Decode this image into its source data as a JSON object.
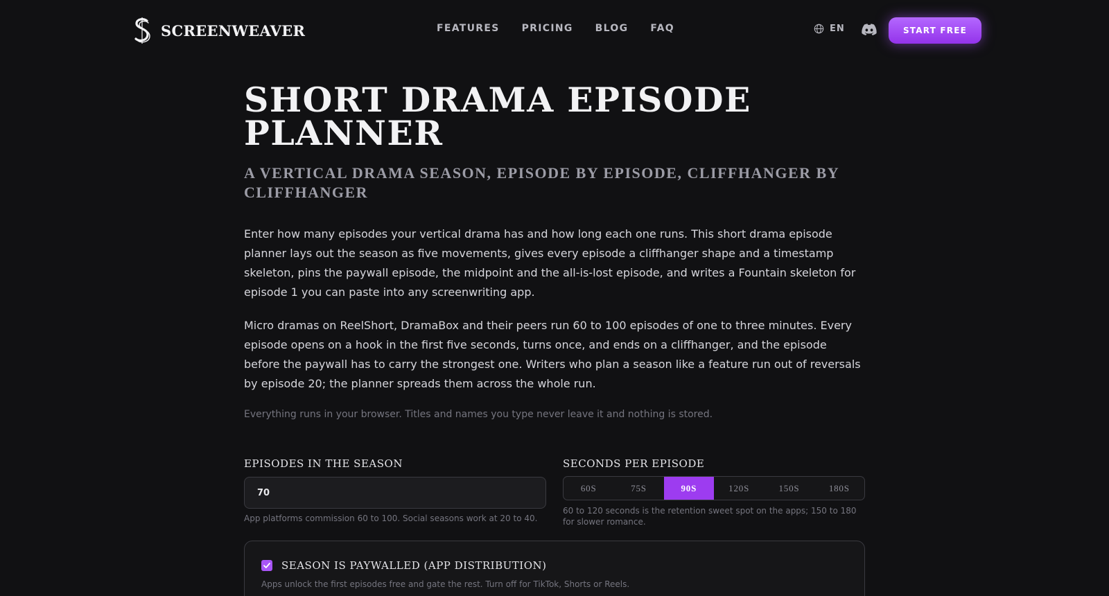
{
  "header": {
    "brand": "SCREENWEAVER",
    "nav": [
      {
        "label": "FEATURES"
      },
      {
        "label": "PRICING"
      },
      {
        "label": "BLOG"
      },
      {
        "label": "FAQ"
      }
    ],
    "language": "EN",
    "cta_label": "START FREE"
  },
  "page": {
    "title": "SHORT DRAMA EPISODE PLANNER",
    "subtitle": "A VERTICAL DRAMA SEASON, EPISODE BY EPISODE, CLIFFHANGER BY CLIFFHANGER",
    "intro": "Enter how many episodes your vertical drama has and how long each one runs. This short drama episode planner lays out the season as five movements, gives every episode a cliffhanger shape and a timestamp skeleton, pins the paywall episode, the midpoint and the all-is-lost episode, and writes a Fountain skeleton for episode 1 you can paste into any screenwriting app.",
    "body": "Micro dramas on ReelShort, DramaBox and their peers run 60 to 100 episodes of one to three minutes. Every episode opens on a hook in the first five seconds, turns once, and ends on a cliffhanger, and the episode before the paywall has to carry the strongest one. Writers who plan a season like a feature run out of reversals by episode 20; the planner spreads them across the whole run.",
    "privacy_note": "Everything runs in your browser. Titles and names you type never leave it and nothing is stored."
  },
  "form": {
    "episodes": {
      "label": "EPISODES IN THE SEASON",
      "value": "70",
      "hint": "App platforms commission 60 to 100. Social seasons work at 20 to 40."
    },
    "seconds": {
      "label": "SECONDS PER EPISODE",
      "options": [
        "60S",
        "75S",
        "90S",
        "120S",
        "150S",
        "180S"
      ],
      "selected": "90S",
      "hint": "60 to 120 seconds is the retention sweet spot on the apps; 150 to 180 for slower romance."
    },
    "paywall": {
      "checked": true,
      "label": "SEASON IS PAYWALLED (APP DISTRIBUTION)",
      "hint": "Apps unlock the first episodes free and gate the rest. Turn off for TikTok, Shorts or Reels."
    }
  },
  "colors": {
    "background": "#111113",
    "accent": "#a855f7",
    "accent_dark": "#9333ea",
    "text": "#e9e9ec",
    "muted": "#75757f"
  },
  "icons": {
    "logo": "logo-s-icon",
    "language": "globe-icon",
    "discord": "discord-icon",
    "checkbox": "check-icon"
  }
}
